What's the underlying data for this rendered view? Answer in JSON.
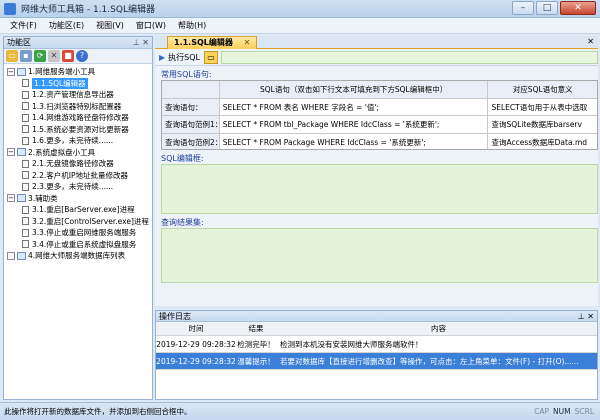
{
  "window": {
    "title": "网维大师工具箱 - 1.1.SQL编辑器",
    "minimize": "–",
    "maximize": "□",
    "close": "✕"
  },
  "menu": [
    {
      "label": "文件(F)"
    },
    {
      "label": "功能区(E)"
    },
    {
      "label": "视图(V)"
    },
    {
      "label": "窗口(W)"
    },
    {
      "label": "帮助(H)"
    }
  ],
  "left_panel": {
    "title": "功能区",
    "pin": "⊥ ✕",
    "tree": [
      {
        "level": 0,
        "expander": "−",
        "label": "1.网维服务端小工具"
      },
      {
        "level": 1,
        "label": "1.1.SQL编辑器",
        "selected": true
      },
      {
        "level": 1,
        "label": "1.2.资产管理信息导出器"
      },
      {
        "level": 1,
        "label": "1.3.扫浏览器特别标配置器"
      },
      {
        "level": 1,
        "label": "1.4.网维游戏路径盘符修改器"
      },
      {
        "level": 1,
        "label": "1.5.系统必要资源对比更新器"
      },
      {
        "level": 1,
        "label": "1.6.更多，未完待续......"
      },
      {
        "level": 0,
        "expander": "−",
        "label": "2.系统虚拟盘小工具"
      },
      {
        "level": 1,
        "label": "2.1.无盘镜像路径修改器"
      },
      {
        "level": 1,
        "label": "2.2.客户机IP地址批量修改器"
      },
      {
        "level": 1,
        "label": "2.3.更多，未完待续......"
      },
      {
        "level": 0,
        "expander": "−",
        "label": "3.辅助类"
      },
      {
        "level": 1,
        "label": "3.1.重启[BarServer.exe]进程"
      },
      {
        "level": 1,
        "label": "3.2.重启[ControlServer.exe]进程"
      },
      {
        "level": 1,
        "label": "3.3.停止或重启网维服务端服务"
      },
      {
        "level": 1,
        "label": "3.4.停止或重启系统虚拟盘服务"
      },
      {
        "level": 0,
        "expander": "",
        "label": "4.网维大师服务端数据库列表"
      }
    ]
  },
  "doc_tab": {
    "label": "1.1.SQL编辑器",
    "close": "✕",
    "panel_close": "✕"
  },
  "exec_bar": {
    "label": "执行SQL"
  },
  "common_sql": {
    "title": "常用SQL语句:",
    "headers": [
      "",
      "SQL语句（双击如下行文本可填充到下方SQL编辑框中）",
      "对应SQL语句意义"
    ],
    "rows": [
      [
        "查询语句：",
        "SELECT * FROM 表名 WHERE 字段名 = '值';",
        "SELECT语句用于从表中选取"
      ],
      [
        "查询语句范例1：",
        "SELECT * FROM tbl_Package WHERE IdcClass = '系统更新';",
        "查询SQLite数据库barserv"
      ],
      [
        "查询语句范例2：",
        "SELECT * FROM Package WHERE IdcClass = '系统更新';",
        "查询Access数据库Data.md"
      ]
    ]
  },
  "sql_editor": {
    "title": "SQL编辑框:"
  },
  "result": {
    "title": "查询结果集:"
  },
  "log": {
    "title": "操作日志",
    "pin": "⊥ ✕",
    "headers": [
      "时间",
      "结果",
      "内容"
    ],
    "rows": [
      {
        "time": "2019-12-29 09:28:32",
        "result": "检测完毕！",
        "content": "检测到本机没有安装网维大师服务端软件！",
        "selected": false
      },
      {
        "time": "2019-12-29 09:28:32",
        "result": "温馨提示！",
        "content": "若要对数据库【直接进行增删改查】等操作，可点击：左上角菜单：文件(F) - 打开(O)......",
        "selected": true
      }
    ]
  },
  "status": {
    "text": "此操作将打开新的数据库文件，并添加到右侧回合框中。",
    "flags": [
      "CAP",
      "NUM",
      "SCRL"
    ]
  },
  "colors": {
    "accent": "#3399ff",
    "tab_active": "#ffcf55",
    "editor_bg": "#e4f4d8"
  }
}
